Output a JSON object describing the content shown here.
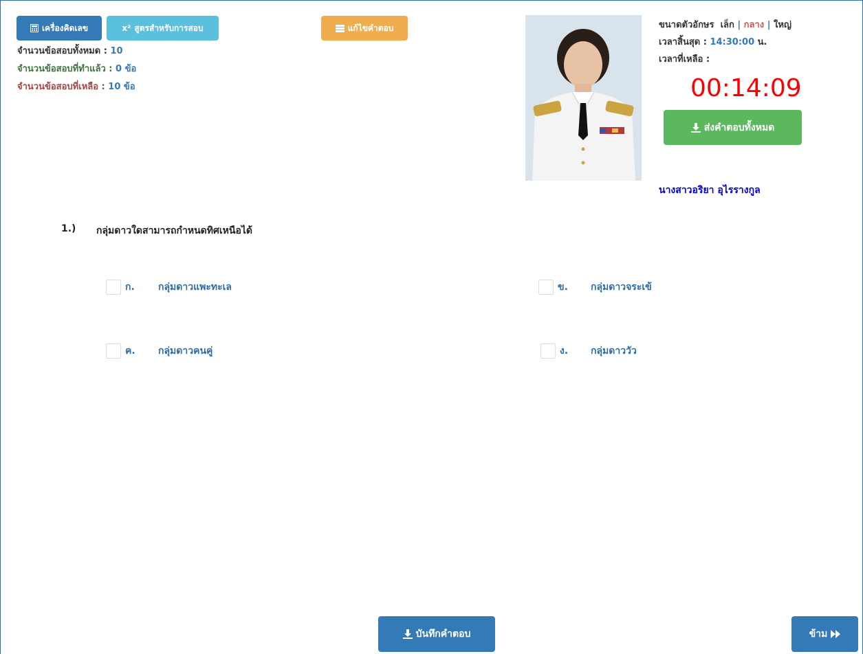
{
  "toolbar": {
    "calculator_label": "เครื่องคิดเลข",
    "formula_prefix": "x²",
    "formula_label": "สูตรสำหรับการสอบ",
    "edit_answer_label": "แก้ไขคำตอบ"
  },
  "stats": {
    "total_label": "จำนวนข้อสอบทั้งหมด :",
    "total_value": "10",
    "done_label": "จำนวนข้อสอบที่ทำแล้ว :",
    "done_value": "0 ข้อ",
    "remaining_label": "จำนวนข้อสอบที่เหลือ :",
    "remaining_value": "10 ข้อ"
  },
  "font_size": {
    "label": "ขนาดตัวอักษร",
    "small": "เล็ก",
    "sep1": "|",
    "medium": "กลาง",
    "sep2": "|",
    "large": "ใหญ่"
  },
  "time": {
    "end_label": "เวลาสิ้นสุด :",
    "end_value": "14:30:00",
    "end_unit": "น.",
    "remaining_label": "เวลาที่เหลือ :",
    "countdown": "00:14:09"
  },
  "submit_all_label": "ส่งคำตอบทั้งหมด",
  "examinee_name": "นางสาวอริยา อุไรรางกูล",
  "question": {
    "number": "1.)",
    "text": "กลุ่มดาวใดสามารถกำหนดทิศเหนือได้",
    "choices": [
      {
        "label": "ก.",
        "text": "กลุ่มดาวแพะทะเล"
      },
      {
        "label": "ข.",
        "text": "กลุ่มดาวจระเข้"
      },
      {
        "label": "ค.",
        "text": "กลุ่มดาวคนคู่"
      },
      {
        "label": "ง.",
        "text": "กลุ่มดาววัว"
      }
    ]
  },
  "footer": {
    "save_label": "บันทึกคำตอบ",
    "skip_label": "ข้าม"
  },
  "colors": {
    "primary": "#337ab7",
    "info": "#5bc0de",
    "warning": "#f0ad4e",
    "success": "#5cb85c",
    "timer": "#ff0000",
    "name": "#0000cc"
  }
}
